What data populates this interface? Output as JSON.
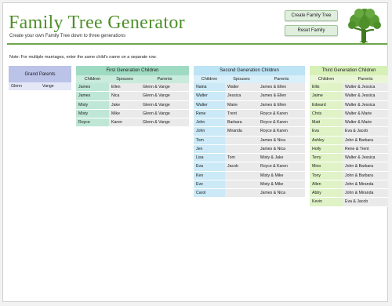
{
  "header": {
    "title": "Family Tree Generator",
    "subtitle": "Create your own Family Tree down to three generations",
    "create_label": "Create Family Tree",
    "reset_label": "Reset Family",
    "logo_icon": "tree-icon"
  },
  "note": "Note: For multiple marriages, enter the same child's name on a separate row.",
  "colors": {
    "title_green": "#4e8f2a",
    "grand_parents": "#bcc3e8",
    "first_gen": "#9fdbc2",
    "second_gen": "#bde4f5",
    "third_gen": "#d7f0b8"
  },
  "grand_parents": {
    "title": "Grand Parents",
    "names": [
      "Glenn",
      "Vange"
    ]
  },
  "first_gen": {
    "title": "First Generation Children",
    "headers": [
      "Children",
      "Spouses",
      "Parents"
    ],
    "rows": [
      [
        "James",
        "Ellen",
        "Glenn & Vange"
      ],
      [
        "James",
        "Nica",
        "Glenn & Vange"
      ],
      [
        "Misty",
        "Jake",
        "Glenn & Vange"
      ],
      [
        "Misty",
        "Mike",
        "Glenn & Vange"
      ],
      [
        "Royce",
        "Karen",
        "Glenn & Vange"
      ]
    ]
  },
  "second_gen": {
    "title": "Second Generation Children",
    "headers": [
      "Children",
      "Spouses",
      "Parents"
    ],
    "rows": [
      [
        "Naina",
        "Walter",
        "James & Ellen"
      ],
      [
        "Walter",
        "Jessica",
        "James & Ellen"
      ],
      [
        "Walter",
        "Marie",
        "James & Ellen"
      ],
      [
        "Rene",
        "Trent",
        "Royce & Karen"
      ],
      [
        "John",
        "Barbara",
        "Royce & Karen"
      ],
      [
        "John",
        "Miranda",
        "Royce & Karen"
      ],
      [
        "Tom",
        "",
        "James & Nica"
      ],
      [
        "Jen",
        "",
        "James & Nica"
      ],
      [
        "Lisa",
        "Tom",
        "Misty & Jake"
      ],
      [
        "Eva",
        "Jacob",
        "Royce & Karen"
      ],
      [
        "Ken",
        "",
        "Misty & Mike"
      ],
      [
        "Eve",
        "",
        "Misty & Mike"
      ],
      [
        "Carol",
        "",
        "James & Nica"
      ]
    ]
  },
  "third_gen": {
    "title": "Third Generation Children",
    "headers": [
      "Children",
      "Parents"
    ],
    "rows": [
      [
        "Ellis",
        "Walter & Jessica"
      ],
      [
        "Jaime",
        "Walter & Jessica"
      ],
      [
        "Edward",
        "Walter & Jessica"
      ],
      [
        "Chris",
        "Walter & Marie"
      ],
      [
        "Matt",
        "Walter & Marie"
      ],
      [
        "Eva",
        "Eva & Jacob"
      ],
      [
        "Ashley",
        "John & Barbara"
      ],
      [
        "Holly",
        "Rene & Trent"
      ],
      [
        "Terry",
        "Walter & Jessica"
      ],
      [
        "Mino",
        "John & Barbara"
      ],
      [
        "Tony",
        "John & Barbara"
      ],
      [
        "Allen",
        "John & Miranda"
      ],
      [
        "Abby",
        "John & Miranda"
      ],
      [
        "Kevin",
        "Eva & Jacob"
      ]
    ]
  }
}
